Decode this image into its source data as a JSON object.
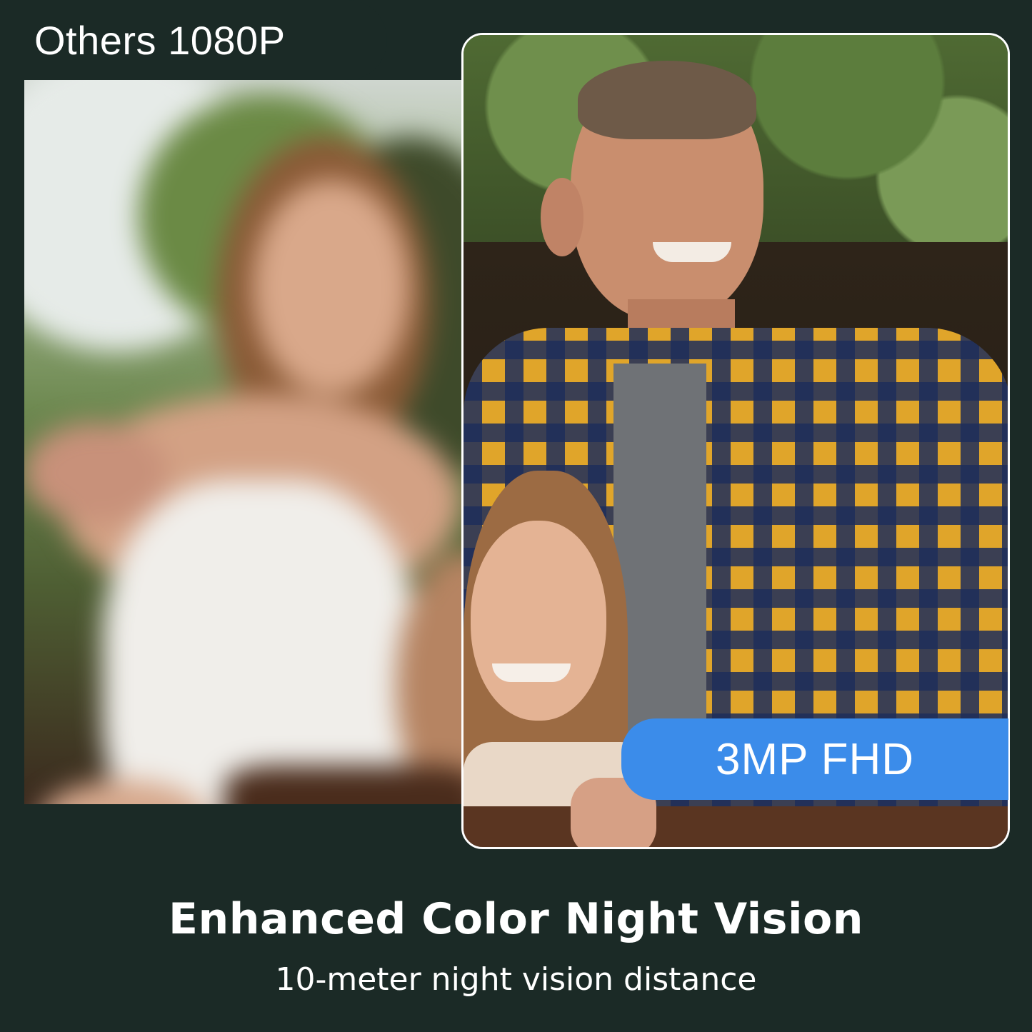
{
  "comparison": {
    "left_label": "Others 1080P",
    "right_label": "3MP FHD"
  },
  "footer": {
    "headline": "Enhanced Color Night Vision",
    "subline": "10-meter night vision distance"
  },
  "colors": {
    "background": "#1b2a26",
    "badge": "#3b8cea",
    "text": "#ffffff"
  }
}
